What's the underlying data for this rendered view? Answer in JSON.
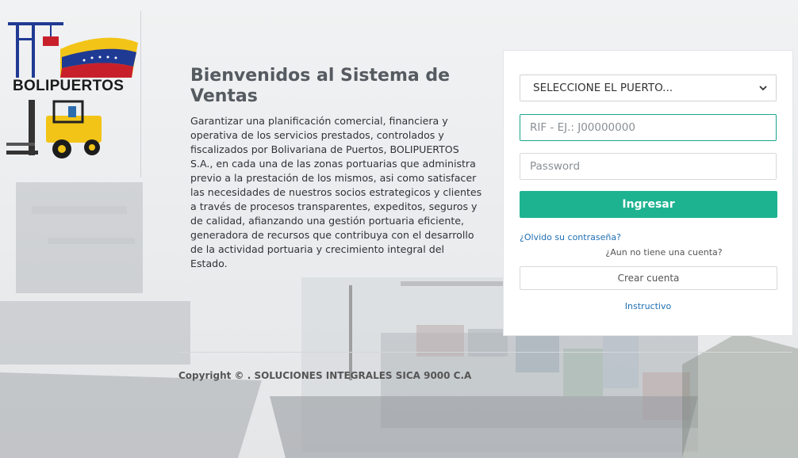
{
  "brand": {
    "name": "BOLIPUERTOS"
  },
  "intro": {
    "title": "Bienvenidos al Sistema de Ventas",
    "body": "Garantizar una planificación comercial, financiera y operativa de los servicios prestados, controlados y fiscalizados por Bolivariana de Puertos, BOLIPUERTOS S.A., en cada una de las zonas portuarias que administra previo a la prestación de los mismos, asi como satisfacer las necesidades de nuestros socios estrategicos y clientes a través de procesos transparentes, expeditos, seguros y de calidad, afianzando una gestión portuaria eficiente, generadora de recursos que contribuya con el desarrollo de la actividad portuaria y crecimiento integral del Estado."
  },
  "login": {
    "port_select": {
      "selected": "SELECCIONE EL PUERTO..."
    },
    "rif_placeholder": "RIF - EJ.: J00000000",
    "rif_value": "",
    "password_placeholder": "Password",
    "password_value": "",
    "submit_label": "Ingresar",
    "forgot_label": "¿Olvido su contraseña?",
    "no_account_label": "¿Aun no tiene una cuenta?",
    "create_label": "Crear cuenta",
    "instructions_label": "Instructivo"
  },
  "footer": {
    "copyright": "Copyright © . SOLUCIONES INTEGRALES SICA 9000 C.A"
  },
  "colors": {
    "primary": "#1db390",
    "link": "#1f6fb2",
    "focus_border": "#1aa58c"
  }
}
